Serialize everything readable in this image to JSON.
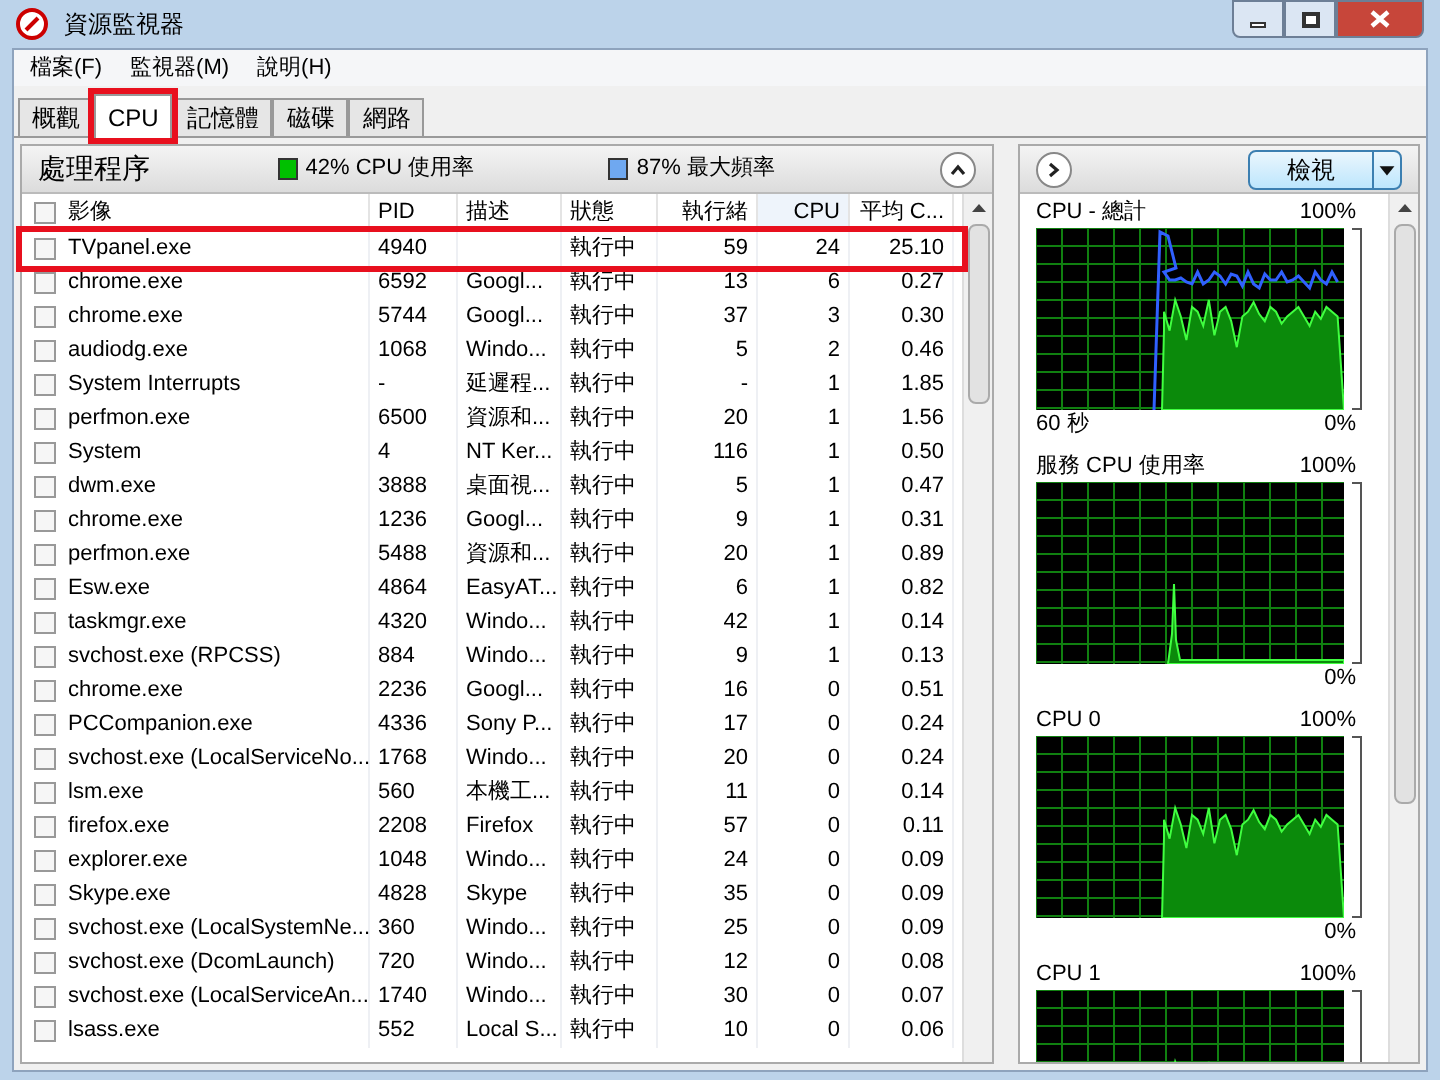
{
  "window": {
    "title": "資源監視器"
  },
  "menu": [
    "檔案(F)",
    "監視器(M)",
    "說明(H)"
  ],
  "tabs": [
    {
      "label": "概觀",
      "selected": false,
      "highlighted": false
    },
    {
      "label": "CPU",
      "selected": true,
      "highlighted": true
    },
    {
      "label": "記憶體",
      "selected": false,
      "highlighted": false
    },
    {
      "label": "磁碟",
      "selected": false,
      "highlighted": false
    },
    {
      "label": "網路",
      "selected": false,
      "highlighted": false
    }
  ],
  "processes": {
    "title": "處理程序",
    "expanded": true,
    "all_checked": false,
    "indicators": [
      {
        "text": "42% CPU 使用率",
        "color": "#00c000"
      },
      {
        "text": "87% 最大頻率",
        "color": "#6fa8f0"
      }
    ],
    "columns": [
      "影像",
      "PID",
      "描述",
      "狀態",
      "執行緒",
      "CPU",
      "平均 C..."
    ],
    "rows": [
      {
        "checked": false,
        "highlighted": true,
        "cells": [
          "TVpanel.exe",
          "4940",
          "",
          "執行中",
          "59",
          "24",
          "25.10"
        ]
      },
      {
        "checked": false,
        "highlighted": false,
        "cells": [
          "chrome.exe",
          "6592",
          "Googl...",
          "執行中",
          "13",
          "6",
          "0.27"
        ]
      },
      {
        "checked": false,
        "highlighted": false,
        "cells": [
          "chrome.exe",
          "5744",
          "Googl...",
          "執行中",
          "37",
          "3",
          "0.30"
        ]
      },
      {
        "checked": false,
        "highlighted": false,
        "cells": [
          "audiodg.exe",
          "1068",
          "Windo...",
          "執行中",
          "5",
          "2",
          "0.46"
        ]
      },
      {
        "checked": false,
        "highlighted": false,
        "cells": [
          "System Interrupts",
          "-",
          "延遲程...",
          "執行中",
          "-",
          "1",
          "1.85"
        ]
      },
      {
        "checked": false,
        "highlighted": false,
        "cells": [
          "perfmon.exe",
          "6500",
          "資源和...",
          "執行中",
          "20",
          "1",
          "1.56"
        ]
      },
      {
        "checked": false,
        "highlighted": false,
        "cells": [
          "System",
          "4",
          "NT Ker...",
          "執行中",
          "116",
          "1",
          "0.50"
        ]
      },
      {
        "checked": false,
        "highlighted": false,
        "cells": [
          "dwm.exe",
          "3888",
          "桌面視...",
          "執行中",
          "5",
          "1",
          "0.47"
        ]
      },
      {
        "checked": false,
        "highlighted": false,
        "cells": [
          "chrome.exe",
          "1236",
          "Googl...",
          "執行中",
          "9",
          "1",
          "0.31"
        ]
      },
      {
        "checked": false,
        "highlighted": false,
        "cells": [
          "perfmon.exe",
          "5488",
          "資源和...",
          "執行中",
          "20",
          "1",
          "0.89"
        ]
      },
      {
        "checked": false,
        "highlighted": false,
        "cells": [
          "Esw.exe",
          "4864",
          "EasyAT...",
          "執行中",
          "6",
          "1",
          "0.82"
        ]
      },
      {
        "checked": false,
        "highlighted": false,
        "cells": [
          "taskmgr.exe",
          "4320",
          "Windo...",
          "執行中",
          "42",
          "1",
          "0.14"
        ]
      },
      {
        "checked": false,
        "highlighted": false,
        "cells": [
          "svchost.exe (RPCSS)",
          "884",
          "Windo...",
          "執行中",
          "9",
          "1",
          "0.13"
        ]
      },
      {
        "checked": false,
        "highlighted": false,
        "cells": [
          "chrome.exe",
          "2236",
          "Googl...",
          "執行中",
          "16",
          "0",
          "0.51"
        ]
      },
      {
        "checked": false,
        "highlighted": false,
        "cells": [
          "PCCompanion.exe",
          "4336",
          "Sony P...",
          "執行中",
          "17",
          "0",
          "0.24"
        ]
      },
      {
        "checked": false,
        "highlighted": false,
        "cells": [
          "svchost.exe (LocalServiceNo...",
          "1768",
          "Windo...",
          "執行中",
          "20",
          "0",
          "0.24"
        ]
      },
      {
        "checked": false,
        "highlighted": false,
        "cells": [
          "lsm.exe",
          "560",
          "本機工...",
          "執行中",
          "11",
          "0",
          "0.14"
        ]
      },
      {
        "checked": false,
        "highlighted": false,
        "cells": [
          "firefox.exe",
          "2208",
          "Firefox",
          "執行中",
          "57",
          "0",
          "0.11"
        ]
      },
      {
        "checked": false,
        "highlighted": false,
        "cells": [
          "explorer.exe",
          "1048",
          "Windo...",
          "執行中",
          "24",
          "0",
          "0.09"
        ]
      },
      {
        "checked": false,
        "highlighted": false,
        "cells": [
          "Skype.exe",
          "4828",
          "Skype",
          "執行中",
          "35",
          "0",
          "0.09"
        ]
      },
      {
        "checked": false,
        "highlighted": false,
        "cells": [
          "svchost.exe (LocalSystemNe...",
          "360",
          "Windo...",
          "執行中",
          "25",
          "0",
          "0.09"
        ]
      },
      {
        "checked": false,
        "highlighted": false,
        "cells": [
          "svchost.exe (DcomLaunch)",
          "720",
          "Windo...",
          "執行中",
          "12",
          "0",
          "0.08"
        ]
      },
      {
        "checked": false,
        "highlighted": false,
        "cells": [
          "svchost.exe (LocalServiceAn...",
          "1740",
          "Windo...",
          "執行中",
          "30",
          "0",
          "0.07"
        ]
      },
      {
        "checked": false,
        "highlighted": false,
        "cells": [
          "lsass.exe",
          "552",
          "Local S...",
          "執行中",
          "10",
          "0",
          "0.06"
        ]
      }
    ]
  },
  "graphs_panel": {
    "view_button": "檢視",
    "graphs": [
      {
        "title": "CPU - 總計",
        "max": "100%",
        "time": "60 秒",
        "min": "0%",
        "kind": "total"
      },
      {
        "title": "服務 CPU 使用率",
        "max": "100%",
        "min": "0%",
        "kind": "spike"
      },
      {
        "title": "CPU 0",
        "max": "100%",
        "min": "0%",
        "kind": "core"
      },
      {
        "title": "CPU 1",
        "max": "100%",
        "kind": "core"
      }
    ]
  }
}
